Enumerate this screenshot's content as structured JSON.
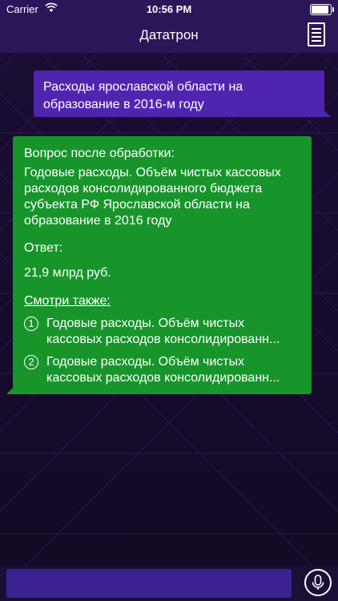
{
  "status_bar": {
    "carrier": "Carrier",
    "time": "10:56 PM",
    "wifi_icon": "wifi-icon",
    "battery_icon": "battery-icon",
    "battery_level": 1.0
  },
  "nav": {
    "title": "Дататрон",
    "menu_icon": "list-icon"
  },
  "messages": {
    "user": "Расходы ярославской области на образование в 2016-м году",
    "bot": {
      "question_heading": "Вопрос после обработки:",
      "question_text": "Годовые расходы. Объём чистых кассовых расходов консолидированного бюджета субъекта РФ Ярославской области на образование в 2016 году",
      "answer_heading": "Ответ:",
      "answer_text": "21,9 млрд руб.",
      "see_also_heading": "Смотри также:",
      "see_also": [
        {
          "number": "1",
          "text": "Годовые расходы. Объём чистых кассовых расходов консолидированн..."
        },
        {
          "number": "2",
          "text": "Годовые расходы. Объём чистых кассовых расходов консолидированн..."
        }
      ]
    }
  },
  "input": {
    "value": "",
    "placeholder": "",
    "mic_icon": "microphone-icon"
  },
  "colors": {
    "bar": "#2b1659",
    "user_bubble": "#4f25b0",
    "bot_bubble": "#17952b",
    "input": "#3c2290"
  }
}
